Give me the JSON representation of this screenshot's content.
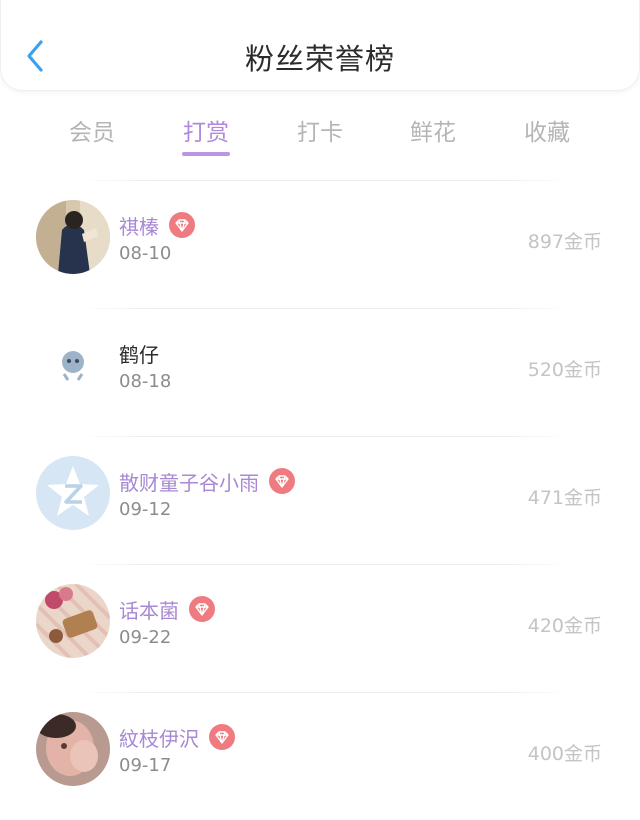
{
  "header": {
    "title": "粉丝荣誉榜",
    "back_icon": "chevron-left-icon"
  },
  "tabs": [
    {
      "label": "会员",
      "active": false
    },
    {
      "label": "打赏",
      "active": true
    },
    {
      "label": "打卡",
      "active": false
    },
    {
      "label": "鲜花",
      "active": false
    },
    {
      "label": "收藏",
      "active": false
    }
  ],
  "colors": {
    "accent": "#b089dc",
    "vip_badge": "#ef7a80",
    "back_arrow": "#3aa0f0"
  },
  "fans": [
    {
      "name": "祺榛",
      "date": "08-10",
      "amount": "897金币",
      "vip": true
    },
    {
      "name": "鹤仔",
      "date": "08-18",
      "amount": "520金币",
      "vip": false
    },
    {
      "name": "散财童子谷小雨",
      "date": "09-12",
      "amount": "471金币",
      "vip": true
    },
    {
      "name": "话本菌",
      "date": "09-22",
      "amount": "420金币",
      "vip": true
    },
    {
      "name": "紋枝伊沢",
      "date": "09-17",
      "amount": "400金币",
      "vip": true
    }
  ]
}
